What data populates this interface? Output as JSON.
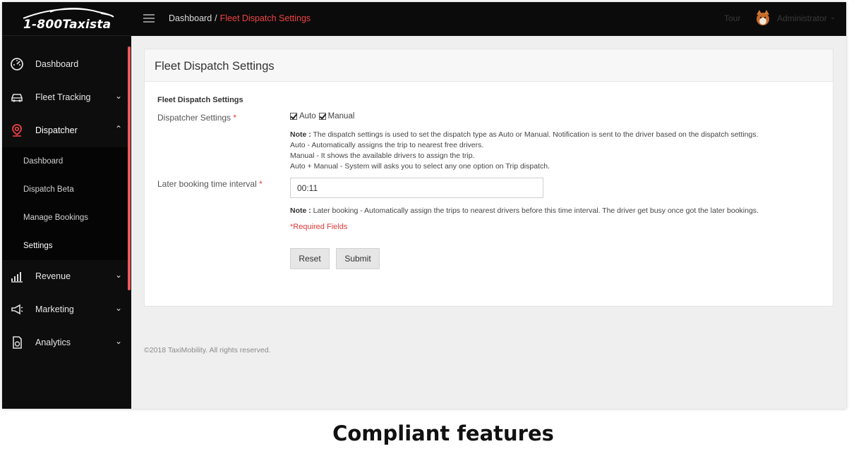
{
  "app": {
    "logo_text": "1-800Taxista",
    "breadcrumb_home": "Dashboard",
    "breadcrumb_sep": "/",
    "breadcrumb_current": "Fleet Dispatch Settings",
    "tour_label": "Tour",
    "user_label": "Administrator",
    "accent_color": "#f04242"
  },
  "sidebar": {
    "items": [
      {
        "label": "Dashboard",
        "icon": "dashboard-gauge-icon"
      },
      {
        "label": "Fleet Tracking",
        "icon": "car-icon",
        "chevron": "down"
      },
      {
        "label": "Dispatcher",
        "icon": "location-pin-icon",
        "chevron": "up"
      },
      {
        "label": "Revenue",
        "icon": "bar-chart-icon",
        "chevron": "down"
      },
      {
        "label": "Marketing",
        "icon": "megaphone-icon",
        "chevron": "down"
      },
      {
        "label": "Analytics",
        "icon": "document-chart-icon",
        "chevron": "down"
      }
    ],
    "sub_items": [
      "Dashboard",
      "Dispatch Beta",
      "Manage Bookings",
      "Settings"
    ]
  },
  "card": {
    "title": "Fleet Dispatch Settings",
    "section_title": "Fleet Dispatch Settings",
    "dispatcher_label": "Dispatcher Settings",
    "required_mark": "*",
    "opt_auto": "Auto",
    "opt_manual": "Manual",
    "auto_checked": true,
    "manual_checked": true,
    "note_prefix": "Note :",
    "note_1": "The dispatch settings is used to set the dispatch type as Auto or Manual. Notification is sent to the driver based on the dispatch settings.",
    "note_2": "Auto - Automatically assigns the trip to nearest free drivers.",
    "note_3": "Manual - It shows the available drivers to assign the trip.",
    "note_4": "Auto + Manual - System will asks you to select any one option on Trip dispatch.",
    "later_label": "Later booking time interval",
    "later_value": "00:11",
    "later_note": "Later booking - Automatically assign the trips to nearest drivers before this time interval. The driver get busy once got the later bookings.",
    "required_fields": "*Required Fields",
    "reset_label": "Reset",
    "submit_label": "Submit"
  },
  "footer": "©2018 TaxiMobility. All rights reserved.",
  "caption": "Compliant features"
}
